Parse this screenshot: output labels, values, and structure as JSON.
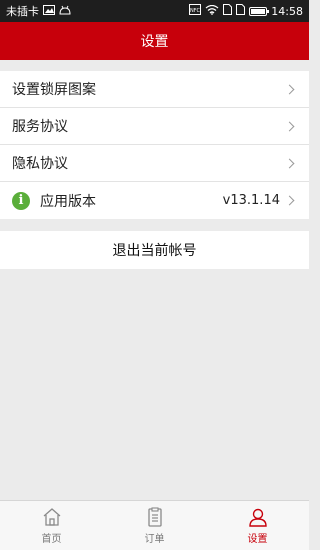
{
  "statusbar": {
    "carrier": "未插卡",
    "time": "14:58",
    "nfc": "NFC"
  },
  "header": {
    "title": "设置"
  },
  "settings": {
    "items": [
      {
        "label": "设置锁屏图案"
      },
      {
        "label": "服务协议"
      },
      {
        "label": "隐私协议"
      },
      {
        "label": "应用版本",
        "value": "v13.1.14"
      }
    ]
  },
  "logout": {
    "label": "退出当前帐号"
  },
  "tabbar": {
    "tabs": [
      {
        "label": "首页",
        "icon": "home-icon"
      },
      {
        "label": "订单",
        "icon": "order-icon"
      },
      {
        "label": "设置",
        "icon": "user-icon"
      }
    ],
    "active_color": "#C7000B"
  },
  "colors": {
    "brand": "#C7000B",
    "info": "#5AAE3A"
  }
}
